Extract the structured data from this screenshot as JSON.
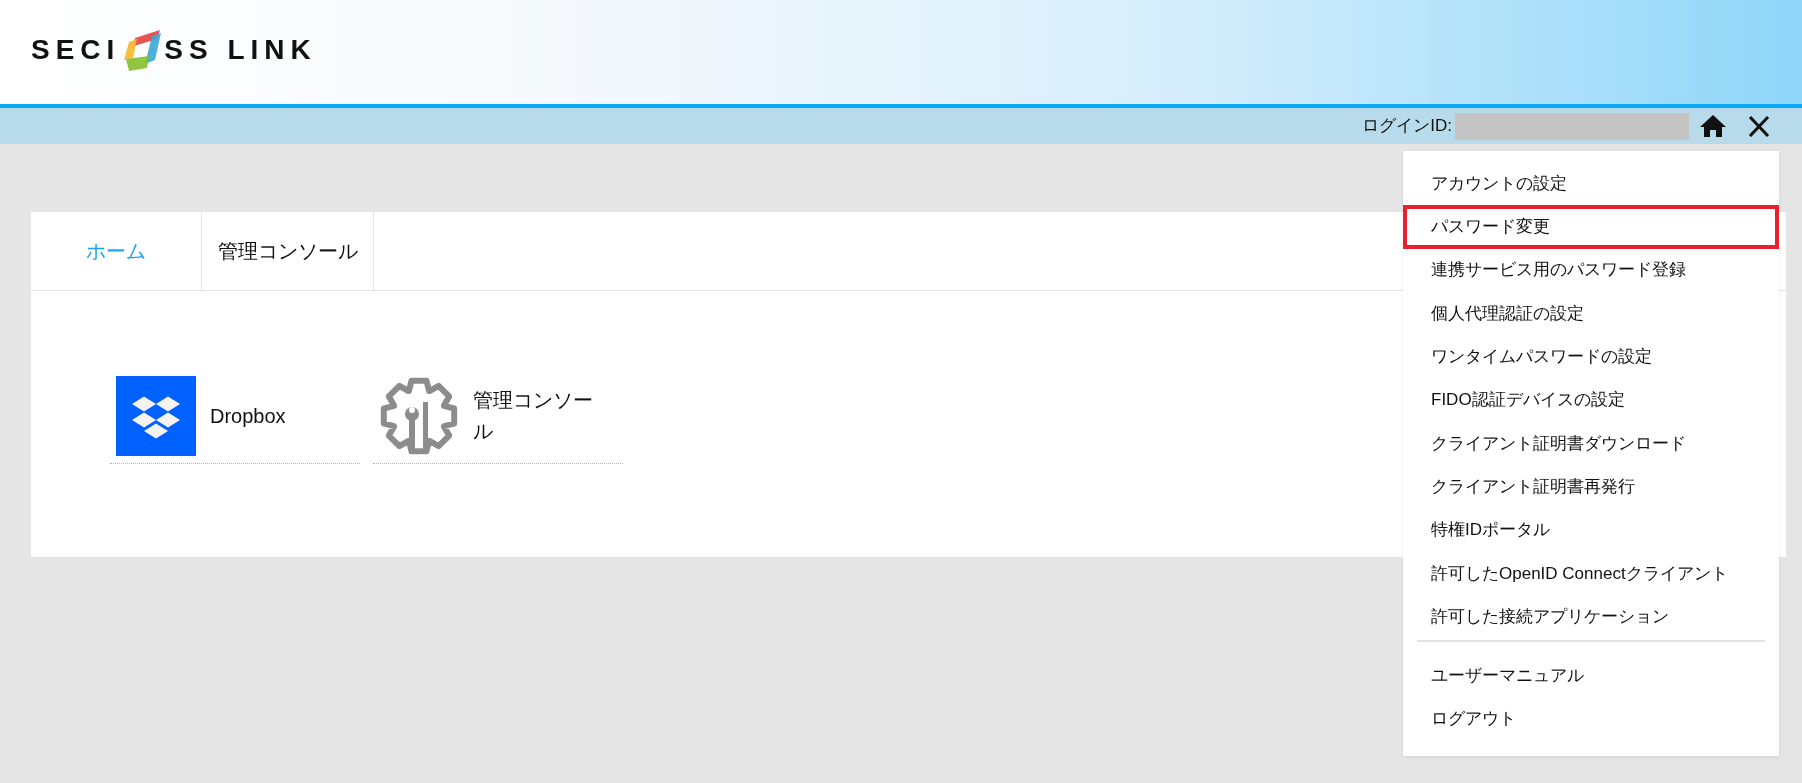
{
  "header": {
    "logo": {
      "text_before": "SECI",
      "text_after": "SS LINK"
    },
    "login_label": "ログインID:"
  },
  "tabs": [
    {
      "label": "ホーム",
      "selected": true
    },
    {
      "label": "管理コンソール",
      "selected": false
    }
  ],
  "apps": [
    {
      "label": "Dropbox",
      "kind": "dropbox"
    },
    {
      "label": "管理コンソール",
      "kind": "admin"
    }
  ],
  "user_menu": {
    "sections": [
      {
        "items": [
          {
            "label": "アカウントの設定",
            "highlighted": false
          },
          {
            "label": "パスワード変更",
            "highlighted": true
          },
          {
            "label": "連携サービス用のパスワード登録",
            "highlighted": false
          },
          {
            "label": "個人代理認証の設定",
            "highlighted": false
          },
          {
            "label": "ワンタイムパスワードの設定",
            "highlighted": false
          },
          {
            "label": "FIDO認証デバイスの設定",
            "highlighted": false
          },
          {
            "label": "クライアント証明書ダウンロード",
            "highlighted": false
          },
          {
            "label": "クライアント証明書再発行",
            "highlighted": false
          },
          {
            "label": "特権IDポータル",
            "highlighted": false
          },
          {
            "label": "許可したOpenID Connectクライアント",
            "highlighted": false
          },
          {
            "label": "許可した接続アプリケーション",
            "highlighted": false
          }
        ]
      },
      {
        "items": [
          {
            "label": "ユーザーマニュアル",
            "highlighted": false
          },
          {
            "label": "ログアウト",
            "highlighted": false
          }
        ]
      }
    ]
  }
}
